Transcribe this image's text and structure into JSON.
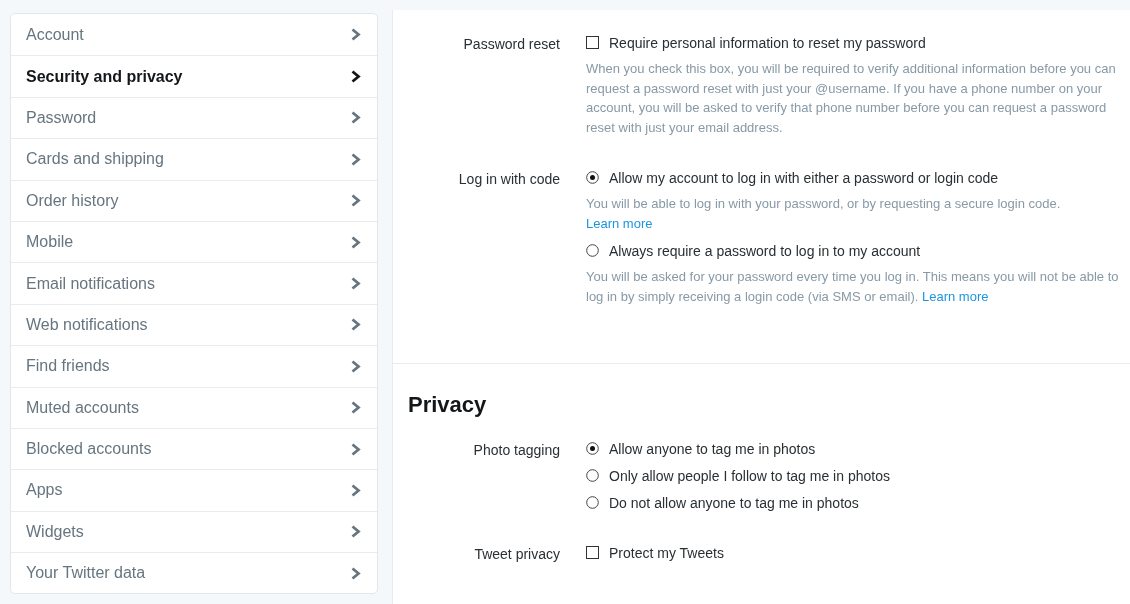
{
  "sidebar": {
    "items": [
      {
        "label": "Account",
        "selected": false
      },
      {
        "label": "Security and privacy",
        "selected": true
      },
      {
        "label": "Password",
        "selected": false
      },
      {
        "label": "Cards and shipping",
        "selected": false
      },
      {
        "label": "Order history",
        "selected": false
      },
      {
        "label": "Mobile",
        "selected": false
      },
      {
        "label": "Email notifications",
        "selected": false
      },
      {
        "label": "Web notifications",
        "selected": false
      },
      {
        "label": "Find friends",
        "selected": false
      },
      {
        "label": "Muted accounts",
        "selected": false
      },
      {
        "label": "Blocked accounts",
        "selected": false
      },
      {
        "label": "Apps",
        "selected": false
      },
      {
        "label": "Widgets",
        "selected": false
      },
      {
        "label": "Your Twitter data",
        "selected": false
      }
    ]
  },
  "sections": [
    {
      "settings": [
        {
          "label": "Password reset",
          "options": [
            {
              "kind": "checkbox",
              "label": "Require personal information to reset my password",
              "checked": false,
              "description": "When you check this box, you will be required to verify additional information before you can request a password reset with just your @username. If you have a phone number on your account, you will be asked to verify that phone number before you can request a password reset with just your email address."
            }
          ]
        },
        {
          "label": "Log in with code",
          "options": [
            {
              "kind": "radio",
              "label": "Allow my account to log in with either a password or login code",
              "selected": true,
              "description": "You will be able to log in with your password, or by requesting a secure login code.",
              "link": "Learn more"
            },
            {
              "kind": "radio",
              "label": "Always require a password to log in to my account",
              "selected": false,
              "description": "You will be asked for your password every time you log in. This means you will not be able to log in by simply receiving a login code (via SMS or email).",
              "link": "Learn more"
            }
          ]
        }
      ]
    },
    {
      "heading": "Privacy",
      "settings": [
        {
          "label": "Photo tagging",
          "options": [
            {
              "kind": "radio",
              "label": "Allow anyone to tag me in photos",
              "selected": true
            },
            {
              "kind": "radio",
              "label": "Only allow people I follow to tag me in photos",
              "selected": false
            },
            {
              "kind": "radio",
              "label": "Do not allow anyone to tag me in photos",
              "selected": false
            }
          ]
        },
        {
          "label": "Tweet privacy",
          "options": [
            {
              "kind": "checkbox",
              "label": "Protect my Tweets",
              "checked": false
            }
          ]
        }
      ]
    }
  ]
}
